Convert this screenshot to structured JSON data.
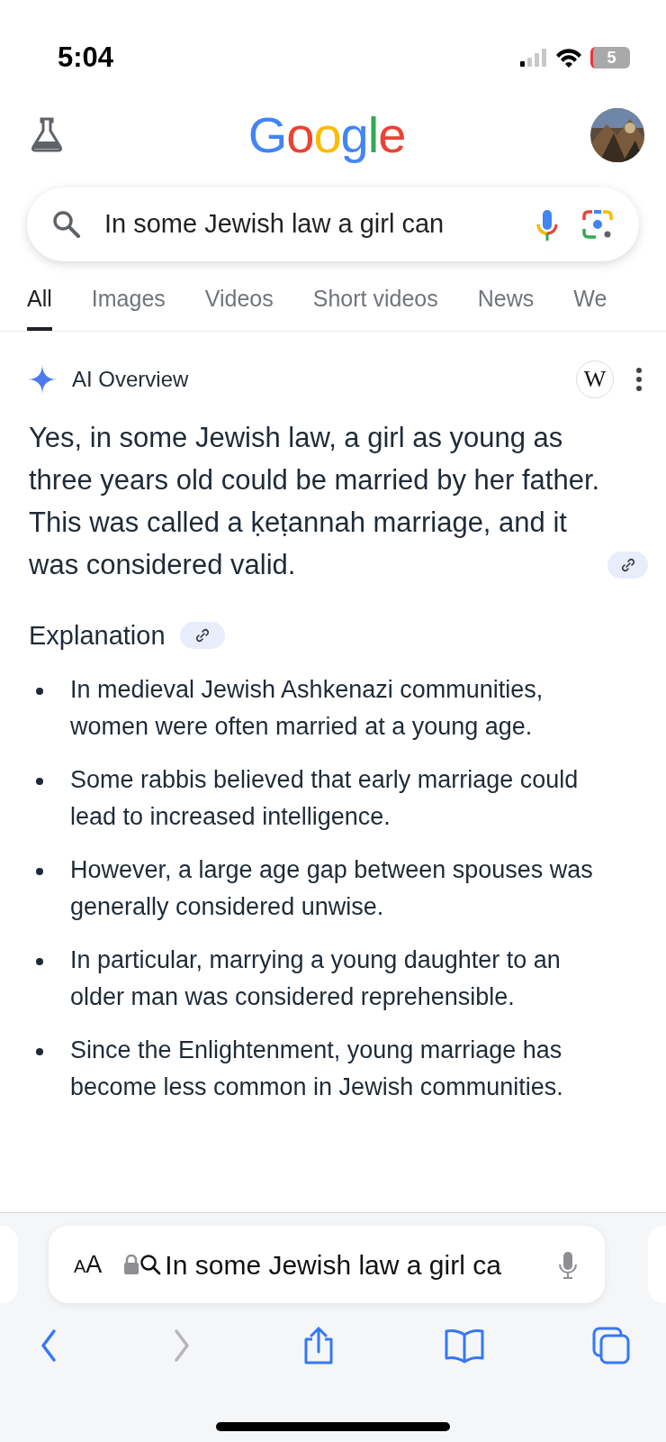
{
  "status_bar": {
    "time": "5:04",
    "battery": "5"
  },
  "header": {
    "logo": "Google"
  },
  "search": {
    "value": "In some Jewish law a girl can"
  },
  "tabs": [
    {
      "label": "All",
      "selected": true
    },
    {
      "label": "Images",
      "selected": false
    },
    {
      "label": "Videos",
      "selected": false
    },
    {
      "label": "Short videos",
      "selected": false
    },
    {
      "label": "News",
      "selected": false
    },
    {
      "label": "We",
      "selected": false
    }
  ],
  "ai_overview": {
    "title": "AI Overview",
    "source_logo": "W",
    "summary": "Yes, in some Jewish law, a girl as young as three years old could be married by her father. This was called a ḳeṭannah marriage, and it was considered valid.",
    "section_title": "Explanation",
    "bullets": [
      "In medieval Jewish Ashkenazi communities, women were often married at a young age.",
      "Some rabbis believed that early marriage could lead to increased intelligence.",
      "However, a large age gap between spouses was generally considered unwise.",
      "In particular, marrying a young daughter to an older man was considered reprehensible.",
      "Since the Enlightenment, young marriage has become less common in Jewish communities."
    ]
  },
  "address_bar": {
    "format_button": "AA",
    "text": "In some Jewish law a girl ca"
  },
  "toolbar": [
    {
      "kind": "back",
      "disabled": false
    },
    {
      "kind": "forward",
      "disabled": true
    },
    {
      "kind": "share",
      "disabled": false
    },
    {
      "kind": "bookmarks",
      "disabled": false
    },
    {
      "kind": "tabs",
      "disabled": false
    }
  ]
}
